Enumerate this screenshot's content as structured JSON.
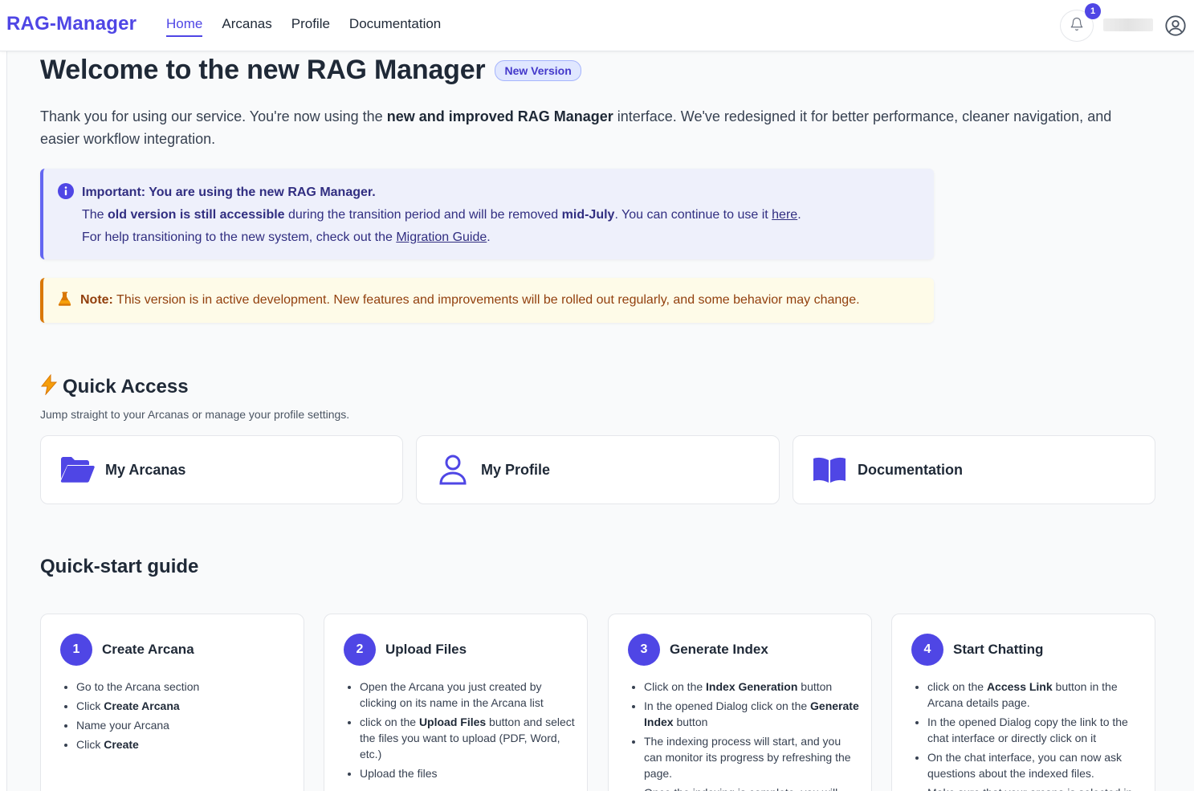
{
  "app": {
    "brand": "RAG-Manager"
  },
  "nav": {
    "items": [
      "Home",
      "Arcanas",
      "Profile",
      "Documentation"
    ],
    "active": "Home"
  },
  "notifications": {
    "count": "1"
  },
  "welcome": {
    "title": "Welcome to the new RAG Manager",
    "badge": "New Version",
    "intro_1": "Thank you for using our service. You're now using the ",
    "intro_bold": "new and improved RAG Manager",
    "intro_2": " interface. We've redesigned it for better performance, cleaner navigation, and easier workflow integration."
  },
  "info_alert": {
    "heading": "Important: You are using the new RAG Manager.",
    "l2_a": "The ",
    "l2_b": "old version is still accessible",
    "l2_c": " during the transition period and will be removed ",
    "l2_d": "mid-July",
    "l2_e": ". You can continue to use it ",
    "l2_link": "here",
    "l2_f": ".",
    "l3_a": "For help transitioning to the new system, check out the ",
    "l3_link": "Migration Guide",
    "l3_b": "."
  },
  "note_alert": {
    "label": "Note:",
    "text": " This version is in active development. New features and improvements will be rolled out regularly, and some behavior may change."
  },
  "quick_access": {
    "title": "Quick Access",
    "subtitle": "Jump straight to your Arcanas or manage your profile settings.",
    "cards": [
      "My Arcanas",
      "My Profile",
      "Documentation"
    ]
  },
  "quick_start": {
    "title": "Quick-start guide",
    "steps": [
      {
        "num": "1",
        "title": "Create Arcana"
      },
      {
        "num": "2",
        "title": "Upload Files"
      },
      {
        "num": "3",
        "title": "Generate Index"
      },
      {
        "num": "4",
        "title": "Start Chatting"
      }
    ],
    "s1": {
      "i1": "Go to the Arcana section",
      "i2a": "Click ",
      "i2b": "Create Arcana",
      "i3": "Name your Arcana",
      "i4a": "Click ",
      "i4b": "Create"
    },
    "s2": {
      "i1": "Open the Arcana you just created by clicking on its name in the Arcana list",
      "i2a": "click on the ",
      "i2b": "Upload Files",
      "i2c": " button and select the files you want to upload (PDF, Word, etc.)",
      "i3": "Upload the files"
    },
    "s3": {
      "i1a": "Click on the ",
      "i1b": "Index Generation",
      "i1c": " button",
      "i2a": "In the opened Dialog click on the ",
      "i2b": "Generate Index",
      "i2c": " button",
      "i3": "The indexing process will start, and you can monitor its progress by refreshing the page.",
      "i4": "Once the indexing is complete, you will"
    },
    "s4": {
      "i1a": "click on the ",
      "i1b": "Access Link",
      "i1c": " button in the Arcana details page.",
      "i2": "In the opened Dialog copy the link to the chat interface or directly click on it",
      "i3": "On the chat interface, you can now ask questions about the indexed files.",
      "i4": "Make sure that your arcana is selected in"
    }
  },
  "colors": {
    "accent": "#4f46e5",
    "info_border": "#6366f1",
    "note_border": "#d97706",
    "note_text": "#92400e"
  }
}
